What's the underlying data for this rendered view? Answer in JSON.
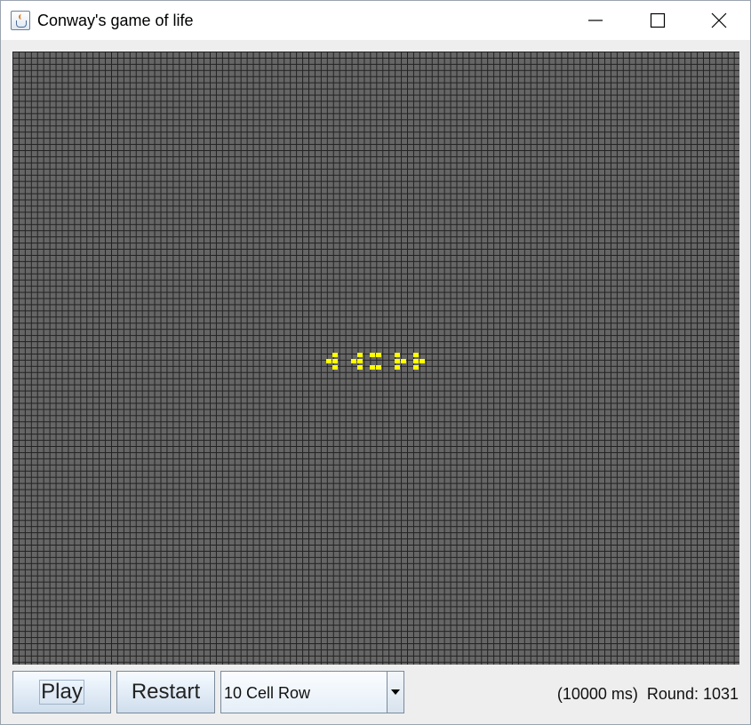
{
  "window": {
    "title": "Conway's game of life",
    "app_icon": "java-cup-icon",
    "controls": [
      "minimize-icon",
      "maximize-icon",
      "close-icon"
    ]
  },
  "board": {
    "background_color": "#666666",
    "grid_line_color": "#222222",
    "live_cell_color": "#ffff00"
  },
  "controls": {
    "play_label": "Play",
    "restart_label": "Restart",
    "pattern_selected": "10 Cell Row"
  },
  "status": {
    "interval_text": "(10000 ms)",
    "round_text": "Round: 1031"
  }
}
